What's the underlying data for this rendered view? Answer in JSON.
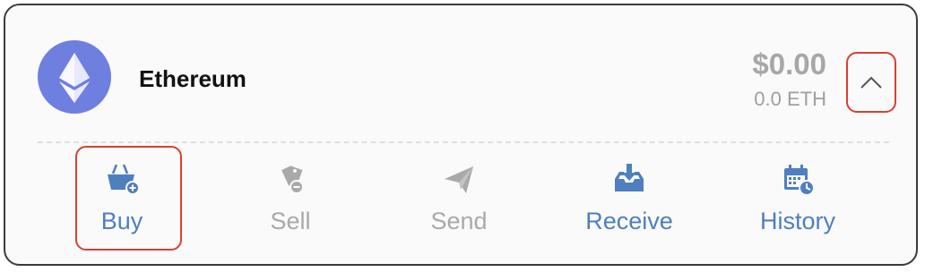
{
  "asset": {
    "name": "Ethereum",
    "logo_icon": "ethereum-logo-icon",
    "fiat_balance": "$0.00",
    "crypto_balance": "0.0 ETH"
  },
  "actions": {
    "buy": {
      "label": "Buy",
      "icon": "basket-add-icon",
      "enabled": true
    },
    "sell": {
      "label": "Sell",
      "icon": "tag-remove-icon",
      "enabled": false
    },
    "send": {
      "label": "Send",
      "icon": "paper-plane-icon",
      "enabled": false
    },
    "receive": {
      "label": "Receive",
      "icon": "inbox-download-icon",
      "enabled": true
    },
    "history": {
      "label": "History",
      "icon": "calendar-clock-icon",
      "enabled": true
    }
  },
  "colors": {
    "accent": "#4e7fbe",
    "disabled": "#a9a9a9",
    "highlight": "#d9402f",
    "eth_purple": "#6f7fe0"
  }
}
